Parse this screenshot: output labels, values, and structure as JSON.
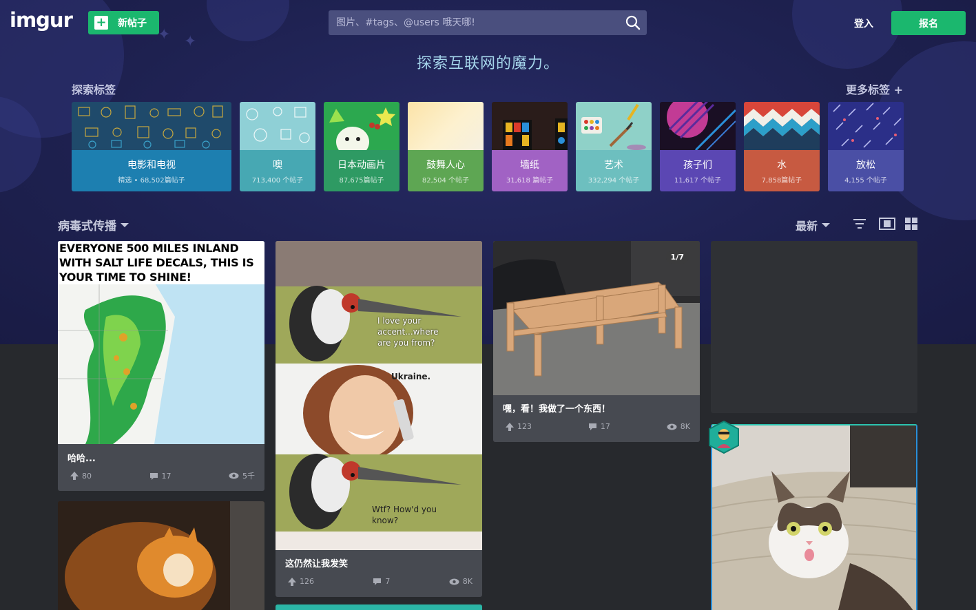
{
  "header": {
    "logo": "imgur",
    "new_post_label": "新帖子",
    "search_placeholder": "图片、#tags、@users 哦天哪!",
    "signin_label": "登入",
    "signup_label": "报名"
  },
  "hero": {
    "tagline": "探索互联网的魔力。",
    "explore_label": "探索标签",
    "more_tags_label": "更多标签 +"
  },
  "tags": [
    {
      "name": "电影和电视",
      "count": "精选 • 68,502篇帖子",
      "color": "#1d7fb0"
    },
    {
      "name": "噢",
      "count": "713,400 个帖子",
      "color": "#47a8b3"
    },
    {
      "name": "日本动画片",
      "count": "87,675篇帖子",
      "color": "#2e9a63"
    },
    {
      "name": "鼓舞人心",
      "count": "82,504 个帖子",
      "color": "#5ea653"
    },
    {
      "name": "墙纸",
      "count": "31,618 篇帖子",
      "color": "#a162c4"
    },
    {
      "name": "艺术",
      "count": "332,294 个帖子",
      "color": "#6dbfbf"
    },
    {
      "name": "孩子们",
      "count": "11,617 个帖子",
      "color": "#5b47b3"
    },
    {
      "name": "水",
      "count": "7,858篇帖子",
      "color": "#c75a41"
    },
    {
      "name": "放松",
      "count": "4,155 个帖子",
      "color": "#4a4fa5"
    }
  ],
  "feed": {
    "section_label": "病毒式传播",
    "sort_label": "最新"
  },
  "posts": [
    {
      "title": "哈哈...",
      "upvotes": "80",
      "comments": "17",
      "views": "5千",
      "meme_text": "EVERYONE 500 MILES INLAND WITH SALT LIFE DECALS, THIS IS YOUR TIME TO SHINE!"
    },
    {
      "title": "这仍然让我发笑",
      "upvotes": "126",
      "comments": "7",
      "views": "8K",
      "caption1": "I love your accent...where are you from?",
      "caption2": "Ukraine.",
      "caption3": "Wtf? How'd you know?"
    },
    {
      "title": "嘿，看！我做了一个东西！",
      "upvotes": "123",
      "comments": "17",
      "views": "8K",
      "page_badge": "1/7"
    }
  ]
}
